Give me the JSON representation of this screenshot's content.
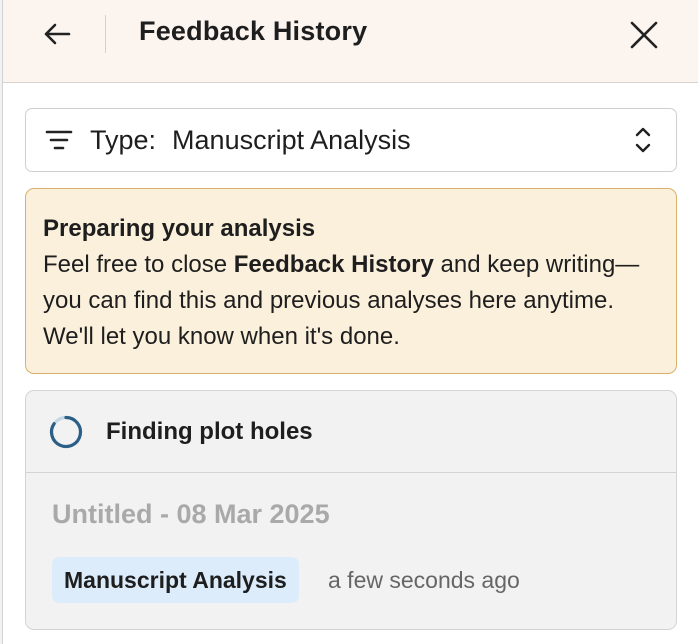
{
  "header": {
    "title": "Feedback History",
    "back_icon": "arrow-left-icon",
    "close_icon": "close-icon"
  },
  "filter": {
    "label": "Type:",
    "value": "Manuscript Analysis",
    "icon": "filter-lines-icon",
    "chevron_icon": "chevron-up-down-icon"
  },
  "notice": {
    "title": "Preparing your analysis",
    "body_prefix": "Feel free to close ",
    "body_bold": "Feedback History",
    "body_suffix": " and keep writing—you can find this and previous analyses here anytime. We'll let you know when it's done."
  },
  "analysis_card": {
    "status": "Finding plot holes",
    "status_icon": "loading-spinner-icon",
    "title": "Untitled - 08 Mar 2025",
    "type_chip": "Manuscript Analysis",
    "timestamp": "a few seconds ago"
  },
  "colors": {
    "header_bg": "#fbf4ef",
    "notice_bg": "#fbf0dc",
    "notice_border": "#d8b16a",
    "chip_bg": "#dcecfb",
    "spinner": "#2c5f86"
  }
}
